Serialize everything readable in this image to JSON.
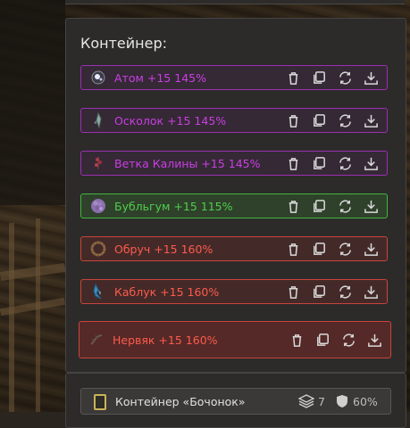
{
  "panel": {
    "title": "Контейнер:",
    "items": [
      {
        "label": "Атом +15 145%",
        "rarity": "purple",
        "icon": "atom-icon"
      },
      {
        "label": "Осколок +15 145%",
        "rarity": "purple",
        "icon": "shard-icon"
      },
      {
        "label": "Ветка Калины +15 145%",
        "rarity": "purple",
        "icon": "viburnum-branch-icon"
      },
      {
        "label": "Бубльгум +15 115%",
        "rarity": "green",
        "icon": "bubblegum-icon"
      },
      {
        "label": "Обруч +15 160%",
        "rarity": "red",
        "icon": "hoop-icon"
      },
      {
        "label": "Каблук +15 160%",
        "rarity": "red",
        "icon": "heel-icon"
      },
      {
        "label": "Нервяк +15 160%",
        "rarity": "red",
        "icon": "nerve-icon"
      }
    ],
    "action_icons": [
      "trash-icon",
      "copy-icon",
      "swap-icon",
      "download-icon"
    ]
  },
  "container": {
    "name": "Контейнер «Бочонок»",
    "slots": "7",
    "protection": "60%",
    "icon": "barrel-container-icon"
  },
  "colors": {
    "purple": "#c93fe3",
    "green": "#4fcf4a",
    "red": "#ff5a4e"
  }
}
